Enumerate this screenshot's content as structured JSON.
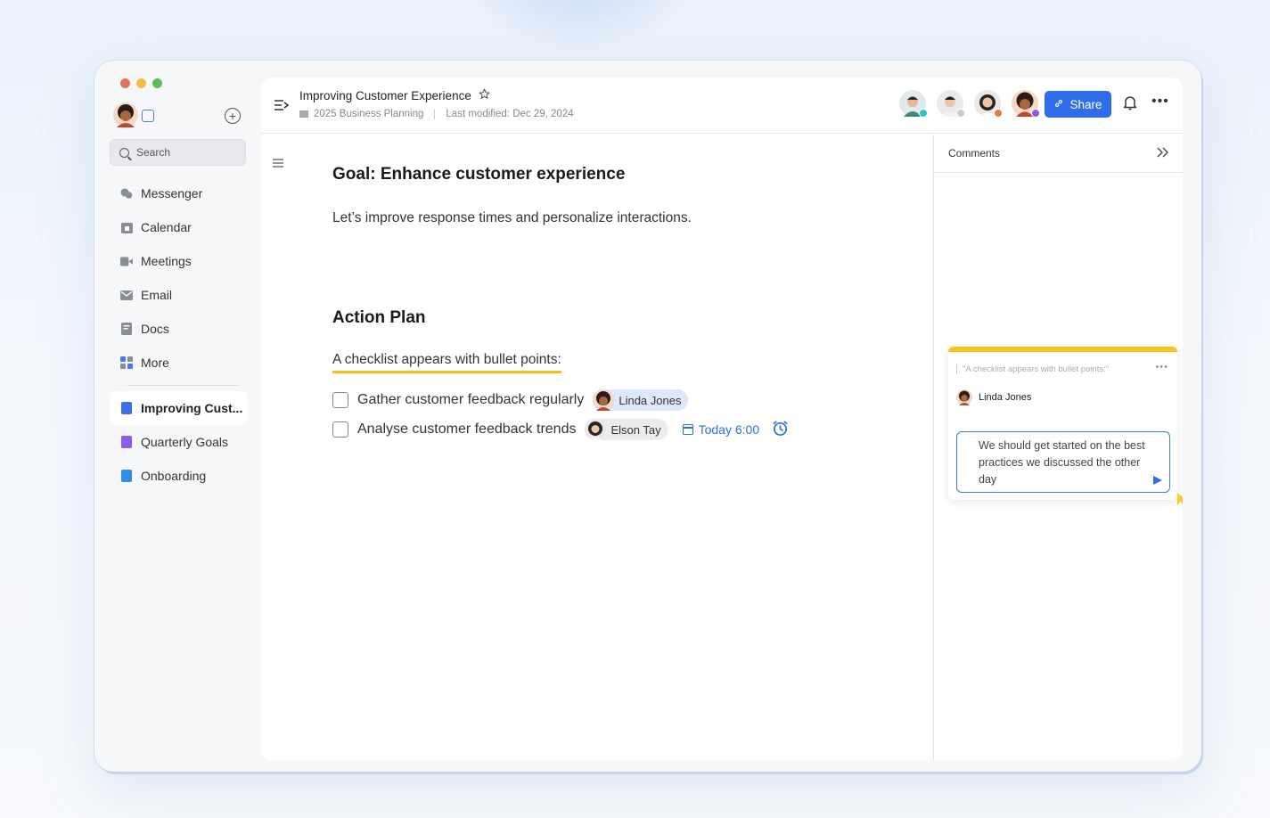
{
  "sidebar": {
    "search_placeholder": "Search",
    "nav": [
      {
        "label": "Messenger",
        "icon": "messenger-icon"
      },
      {
        "label": "Calendar",
        "icon": "calendar-icon"
      },
      {
        "label": "Meetings",
        "icon": "video-icon"
      },
      {
        "label": "Email",
        "icon": "mail-icon"
      },
      {
        "label": "Docs",
        "icon": "docs-icon"
      },
      {
        "label": "More",
        "icon": "apps-icon"
      }
    ],
    "docs": [
      {
        "label": "Improving Cust...",
        "color": "#3f6fe6",
        "active": true
      },
      {
        "label": "Quarterly Goals",
        "color": "#8b5ce6",
        "active": false
      },
      {
        "label": "Onboarding",
        "color": "#2f8de8",
        "active": false
      }
    ]
  },
  "header": {
    "title": "Improving Customer Experience",
    "folder": "2025 Business Planning",
    "last_modified": "Last modified: Dec 29, 2024",
    "share_label": "Share",
    "brand_color": "#2f6ee8"
  },
  "document": {
    "goal_heading": "Goal: Enhance customer experience",
    "goal_text": "Let’s improve response times and personalize interactions.",
    "plan_heading": "Action Plan",
    "checklist_title": "A checklist appears with bullet points:",
    "tasks": [
      {
        "label": "Gather customer feedback regularly",
        "assignee": "Linda Jones",
        "checked": false
      },
      {
        "label": "Analyse customer feedback trends",
        "assignee": "Elson Tay",
        "checked": false,
        "due": "Today 6:00"
      }
    ]
  },
  "comments": {
    "header": "Comments",
    "card": {
      "quote": "\"A checklist appears with bullet points:\"",
      "author": "Linda Jones",
      "reply": "We should get started on the best practices we discussed the other day",
      "accent": "#f9c11b"
    }
  }
}
